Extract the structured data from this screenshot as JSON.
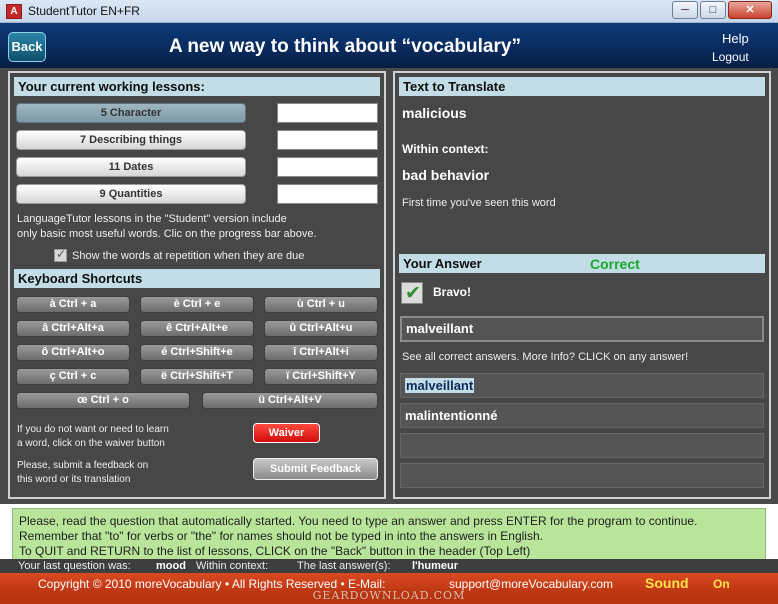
{
  "window": {
    "title": "StudentTutor EN+FR",
    "icon_letter": "A",
    "min": "─",
    "max": "□",
    "close": "✕"
  },
  "header": {
    "back": "Back",
    "title": "A new way to think about “vocabulary”",
    "help": "Help",
    "logout": "Logout"
  },
  "lessons": {
    "heading": "Your current working lessons:",
    "items": [
      {
        "label": "5 Character",
        "value": ""
      },
      {
        "label": "7 Describing things",
        "value": ""
      },
      {
        "label": "11 Dates",
        "value": ""
      },
      {
        "label": "9 Quantities",
        "value": ""
      }
    ],
    "note_line1": "LanguageTutor lessons in the \"Student\" version include",
    "note_line2": "only basic most useful words. Clic on the progress bar above.",
    "repetition_label": "Show the words at repetition when they are due",
    "repetition_checked": true
  },
  "shortcuts": {
    "heading": "Keyboard Shortcuts",
    "rows": [
      [
        "à  Ctrl + a",
        "è  Ctrl + e",
        "ù  Ctrl + u"
      ],
      [
        "â  Ctrl+Alt+a",
        "ê  Ctrl+Alt+e",
        "û  Ctrl+Alt+u"
      ],
      [
        "ô  Ctrl+Alt+o",
        "é  Ctrl+Shift+e",
        "î  Ctrl+Alt+i"
      ],
      [
        "ç  Ctrl + c",
        "ë  Ctrl+Shift+T",
        "ï  Ctrl+Shift+Y"
      ],
      [
        "œ  Ctrl + o",
        "ü  Ctrl+Alt+V"
      ]
    ]
  },
  "waiver": {
    "text1": "If you do not want or need to learn",
    "text2": "a word, click on the waiver button",
    "button": "Waiver"
  },
  "feedback": {
    "text1": "Please, submit a feedback on",
    "text2": "this word or its translation",
    "button": "Submit Feedback"
  },
  "translate": {
    "heading": "Text to Translate",
    "word": "malicious",
    "context_label": "Within context:",
    "context": "bad behavior",
    "first_time": "First time you've seen this word"
  },
  "answer": {
    "heading": "Your Answer",
    "status": "Correct",
    "bravo": "Bravo!",
    "input_value": "malveillant",
    "see_all": "See all correct answers. More Info? CLICK on any answer!",
    "answers": [
      "malveillant",
      "malintentionné",
      "",
      ""
    ]
  },
  "status": {
    "line1": "Please, read the question that automatically started. You need to type an answer and press ENTER for the program to continue.",
    "line2": "Remember that \"to\" for verbs or \"the\" for names should not be typed in into the answers in English.",
    "line3": "To QUIT and RETURN to the list of lessons, CLICK on the \"Back\" button in the header (Top Left)"
  },
  "last": {
    "label": "Your last question was:",
    "question": "mood",
    "context_label": "Within context:",
    "answers_label": "The last answer(s):",
    "answers": "l'humeur"
  },
  "footer": {
    "copyright": "Copyright © 2010 moreVocabulary  •  All Rights Reserved  •  E-Mail:",
    "email": "support@moreVocabulary.com",
    "sound": "Sound",
    "sound_state": "On",
    "watermark": "GEARDOWNLOAD.COM"
  },
  "colors": {
    "header": "#0a2a5c",
    "panel": "#474747",
    "section": "#c3dde6",
    "status": "#b9e59a",
    "footer": "#c23d18",
    "correct": "#1aa82c",
    "waiver": "#e01515"
  }
}
